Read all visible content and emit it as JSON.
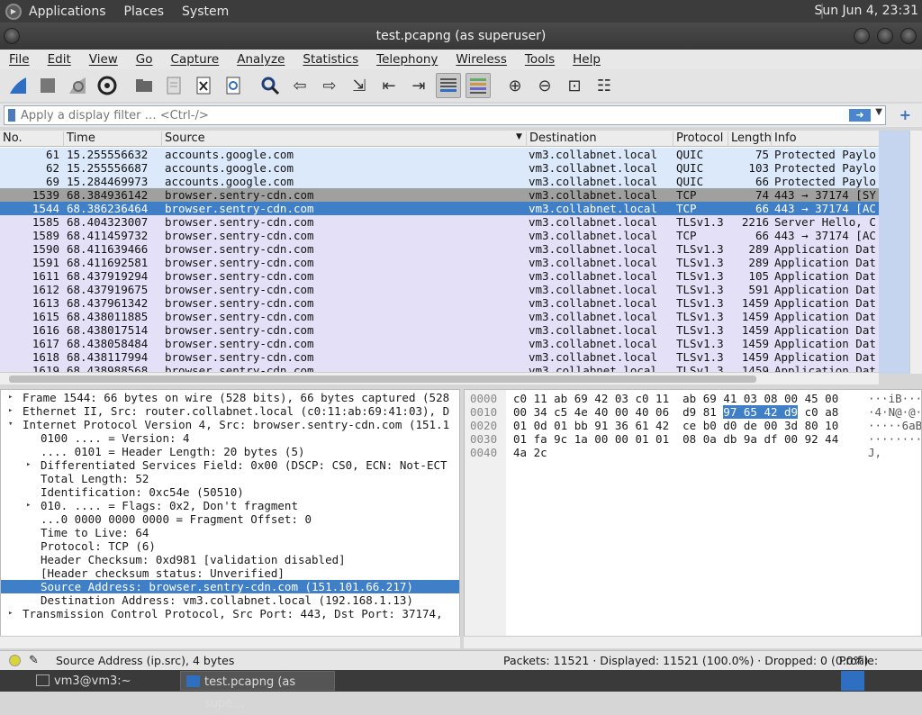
{
  "topbar": {
    "menus": [
      "Applications",
      "Places",
      "System"
    ],
    "clock": "Sun Jun  4, 23:31"
  },
  "window": {
    "title": "test.pcapng (as superuser)"
  },
  "menubar": [
    "File",
    "Edit",
    "View",
    "Go",
    "Capture",
    "Analyze",
    "Statistics",
    "Telephony",
    "Wireless",
    "Tools",
    "Help"
  ],
  "toolbar": {
    "icons": [
      "shark-fin-icon",
      "stop-icon",
      "restart-icon",
      "options-gear-icon",
      "open-folder-icon",
      "file-icon",
      "close-file-icon",
      "reload-icon",
      "search-icon",
      "back-arrow-icon",
      "forward-arrow-icon",
      "goto-packet-icon",
      "first-packet-icon",
      "last-packet-icon",
      "autoscroll-icon",
      "colorize-icon",
      "zoom-in-icon",
      "zoom-out-icon",
      "normal-size-icon",
      "resize-columns-icon"
    ]
  },
  "filter": {
    "placeholder": "Apply a display filter … <Ctrl-/>"
  },
  "packet_list": {
    "columns": [
      "No.",
      "Time",
      "Source",
      "Destination",
      "Protocol",
      "Length",
      "Info"
    ],
    "rows": [
      {
        "no": "61",
        "time": "15.255556632",
        "src": "accounts.google.com",
        "dst": "vm3.collabnet.local",
        "proto": "QUIC",
        "len": "75",
        "info": "Protected Paylo",
        "bg": "#dbe9fb",
        "fg": "#121212"
      },
      {
        "no": "62",
        "time": "15.255556687",
        "src": "accounts.google.com",
        "dst": "vm3.collabnet.local",
        "proto": "QUIC",
        "len": "103",
        "info": "Protected Paylo",
        "bg": "#dbe9fb",
        "fg": "#121212"
      },
      {
        "no": "69",
        "time": "15.284469973",
        "src": "accounts.google.com",
        "dst": "vm3.collabnet.local",
        "proto": "QUIC",
        "len": "66",
        "info": "Protected Paylo",
        "bg": "#dbe9fb",
        "fg": "#121212"
      },
      {
        "no": "1539",
        "time": "68.384936142",
        "src": "browser.sentry-cdn.com",
        "dst": "vm3.collabnet.local",
        "proto": "TCP",
        "len": "74",
        "info": "443 → 37174 [SY",
        "bg": "#a0a0a0",
        "fg": "#121212"
      },
      {
        "no": "1544",
        "time": "68.386236464",
        "src": "browser.sentry-cdn.com",
        "dst": "vm3.collabnet.local",
        "proto": "TCP",
        "len": "66",
        "info": "443 → 37174 [AC",
        "bg": "#3f7fc7",
        "fg": "#ffffff"
      },
      {
        "no": "1585",
        "time": "68.404323007",
        "src": "browser.sentry-cdn.com",
        "dst": "vm3.collabnet.local",
        "proto": "TLSv1.3",
        "len": "2216",
        "info": "Server Hello, C",
        "bg": "#e4e0f8",
        "fg": "#121212"
      },
      {
        "no": "1589",
        "time": "68.411459732",
        "src": "browser.sentry-cdn.com",
        "dst": "vm3.collabnet.local",
        "proto": "TCP",
        "len": "66",
        "info": "443 → 37174 [AC",
        "bg": "#e4e0f8",
        "fg": "#121212"
      },
      {
        "no": "1590",
        "time": "68.411639466",
        "src": "browser.sentry-cdn.com",
        "dst": "vm3.collabnet.local",
        "proto": "TLSv1.3",
        "len": "289",
        "info": "Application Dat",
        "bg": "#e4e0f8",
        "fg": "#121212"
      },
      {
        "no": "1591",
        "time": "68.411692581",
        "src": "browser.sentry-cdn.com",
        "dst": "vm3.collabnet.local",
        "proto": "TLSv1.3",
        "len": "289",
        "info": "Application Dat",
        "bg": "#e4e0f8",
        "fg": "#121212"
      },
      {
        "no": "1611",
        "time": "68.437919294",
        "src": "browser.sentry-cdn.com",
        "dst": "vm3.collabnet.local",
        "proto": "TLSv1.3",
        "len": "105",
        "info": "Application Dat",
        "bg": "#e4e0f8",
        "fg": "#121212"
      },
      {
        "no": "1612",
        "time": "68.437919675",
        "src": "browser.sentry-cdn.com",
        "dst": "vm3.collabnet.local",
        "proto": "TLSv1.3",
        "len": "591",
        "info": "Application Dat",
        "bg": "#e4e0f8",
        "fg": "#121212"
      },
      {
        "no": "1613",
        "time": "68.437961342",
        "src": "browser.sentry-cdn.com",
        "dst": "vm3.collabnet.local",
        "proto": "TLSv1.3",
        "len": "1459",
        "info": "Application Dat",
        "bg": "#e4e0f8",
        "fg": "#121212"
      },
      {
        "no": "1615",
        "time": "68.438011885",
        "src": "browser.sentry-cdn.com",
        "dst": "vm3.collabnet.local",
        "proto": "TLSv1.3",
        "len": "1459",
        "info": "Application Dat",
        "bg": "#e4e0f8",
        "fg": "#121212"
      },
      {
        "no": "1616",
        "time": "68.438017514",
        "src": "browser.sentry-cdn.com",
        "dst": "vm3.collabnet.local",
        "proto": "TLSv1.3",
        "len": "1459",
        "info": "Application Dat",
        "bg": "#e4e0f8",
        "fg": "#121212"
      },
      {
        "no": "1617",
        "time": "68.438058484",
        "src": "browser.sentry-cdn.com",
        "dst": "vm3.collabnet.local",
        "proto": "TLSv1.3",
        "len": "1459",
        "info": "Application Dat",
        "bg": "#e4e0f8",
        "fg": "#121212"
      },
      {
        "no": "1618",
        "time": "68.438117994",
        "src": "browser.sentry-cdn.com",
        "dst": "vm3.collabnet.local",
        "proto": "TLSv1.3",
        "len": "1459",
        "info": "Application Dat",
        "bg": "#e4e0f8",
        "fg": "#121212"
      },
      {
        "no": "1619",
        "time": "68.438988568",
        "src": "browser.sentry-cdn.com",
        "dst": "vm3.collabnet.local",
        "proto": "TLSv1.3",
        "len": "1459",
        "info": "Application Dat",
        "bg": "#e4e0f8",
        "fg": "#121212"
      }
    ]
  },
  "details": [
    {
      "level": 0,
      "exp": "▸",
      "text": "Frame 1544: 66 bytes on wire (528 bits), 66 bytes captured (528",
      "sel": false
    },
    {
      "level": 0,
      "exp": "▸",
      "text": "Ethernet II, Src: router.collabnet.local (c0:11:ab:69:41:03), D",
      "sel": false
    },
    {
      "level": 0,
      "exp": "▾",
      "text": "Internet Protocol Version 4, Src: browser.sentry-cdn.com (151.1",
      "sel": false
    },
    {
      "level": 1,
      "exp": "",
      "text": "0100 .... = Version: 4",
      "sel": false
    },
    {
      "level": 1,
      "exp": "",
      "text": ".... 0101 = Header Length: 20 bytes (5)",
      "sel": false
    },
    {
      "level": 1,
      "exp": "▸",
      "text": "Differentiated Services Field: 0x00 (DSCP: CS0, ECN: Not-ECT",
      "sel": false
    },
    {
      "level": 1,
      "exp": "",
      "text": "Total Length: 52",
      "sel": false
    },
    {
      "level": 1,
      "exp": "",
      "text": "Identification: 0xc54e (50510)",
      "sel": false
    },
    {
      "level": 1,
      "exp": "▸",
      "text": "010. .... = Flags: 0x2, Don't fragment",
      "sel": false
    },
    {
      "level": 1,
      "exp": "",
      "text": "...0 0000 0000 0000 = Fragment Offset: 0",
      "sel": false
    },
    {
      "level": 1,
      "exp": "",
      "text": "Time to Live: 64",
      "sel": false
    },
    {
      "level": 1,
      "exp": "",
      "text": "Protocol: TCP (6)",
      "sel": false
    },
    {
      "level": 1,
      "exp": "",
      "text": "Header Checksum: 0xd981 [validation disabled]",
      "sel": false
    },
    {
      "level": 1,
      "exp": "",
      "text": "[Header checksum status: Unverified]",
      "sel": false
    },
    {
      "level": 1,
      "exp": "",
      "text": "Source Address: browser.sentry-cdn.com (151.101.66.217)",
      "sel": true
    },
    {
      "level": 1,
      "exp": "",
      "text": "Destination Address: vm3.collabnet.local (192.168.1.13)",
      "sel": false
    },
    {
      "level": 0,
      "exp": "▸",
      "text": "Transmission Control Protocol, Src Port: 443, Dst Port: 37174,",
      "sel": false
    }
  ],
  "hex": [
    {
      "off": "0000",
      "pre": "c0 11 ab 69 42 03 c0 11  ab 69 41 03 08 00 45 00",
      "hl": "",
      "post": "",
      "asc": "···iB···"
    },
    {
      "off": "0010",
      "pre": "00 34 c5 4e 40 00 40 06  d9 81 ",
      "hl": "97 65 42 d9",
      "post": " c0 a8",
      "asc": "·4·N@·@·"
    },
    {
      "off": "0020",
      "pre": "01 0d 01 bb 91 36 61 42  ce b0 d0 de 00 3d 80 10",
      "hl": "",
      "post": "",
      "asc": "·····6aB"
    },
    {
      "off": "0030",
      "pre": "01 fa 9c 1a 00 00 01 01  08 0a db 9a df 00 92 44",
      "hl": "",
      "post": "",
      "asc": "········"
    },
    {
      "off": "0040",
      "pre": "4a 2c",
      "hl": "",
      "post": "",
      "asc": "J,"
    }
  ],
  "status": {
    "field": "Source Address (ip.src), 4 bytes",
    "packets": "Packets: 11521 · Displayed: 11521 (100.0%) · Dropped: 0 (0.0%)",
    "profile": "Profile: Default"
  },
  "taskbar": {
    "tasks": [
      "vm3@vm3:~",
      "test.pcapng (as supe…"
    ]
  }
}
